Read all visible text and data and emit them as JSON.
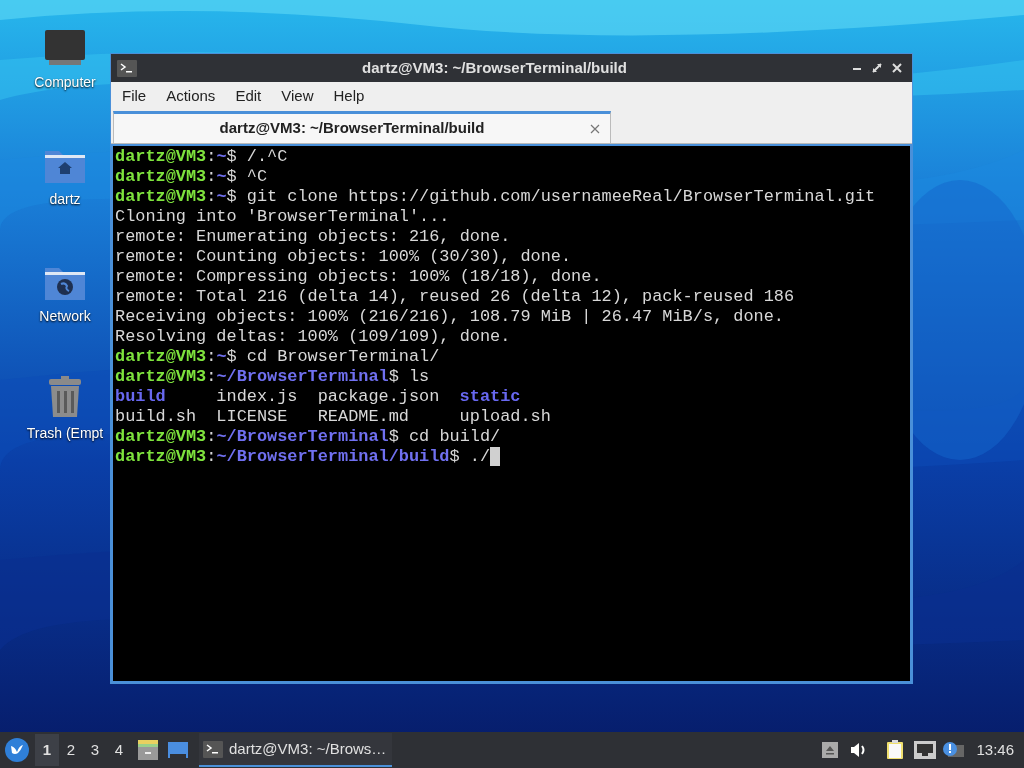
{
  "desktop_icons": [
    {
      "kind": "computer",
      "label": "Computer"
    },
    {
      "kind": "home",
      "label": "dartz"
    },
    {
      "kind": "network",
      "label": "Network"
    },
    {
      "kind": "trash",
      "label": "Trash (Empt"
    }
  ],
  "window": {
    "title": "dartz@VM3: ~/BrowserTerminal/build",
    "menu": [
      "File",
      "Actions",
      "Edit",
      "View",
      "Help"
    ],
    "tabs": [
      {
        "label": "dartz@VM3: ~/BrowserTerminal/build",
        "selected": true
      }
    ],
    "terminal": [
      {
        "kind": "prompt",
        "user": "dartz@VM3",
        "separator": ":",
        "path": "~",
        "prompt_sign": "$",
        "command": "/.^C",
        "cursor": false
      },
      {
        "kind": "prompt",
        "user": "dartz@VM3",
        "separator": ":",
        "path": "~",
        "prompt_sign": "$",
        "command": "^C",
        "cursor": false
      },
      {
        "kind": "prompt",
        "user": "dartz@VM3",
        "separator": ":",
        "path": "~",
        "prompt_sign": "$",
        "command": "git clone https://github.com/usernameeReal/BrowserTerminal.git",
        "cursor": false
      },
      {
        "kind": "output",
        "text": "Cloning into 'BrowserTerminal'..."
      },
      {
        "kind": "output",
        "text": "remote: Enumerating objects: 216, done."
      },
      {
        "kind": "output",
        "text": "remote: Counting objects: 100% (30/30), done."
      },
      {
        "kind": "output",
        "text": "remote: Compressing objects: 100% (18/18), done."
      },
      {
        "kind": "output",
        "text": "remote: Total 216 (delta 14), reused 26 (delta 12), pack-reused 186"
      },
      {
        "kind": "output",
        "text": "Receiving objects: 100% (216/216), 108.79 MiB | 26.47 MiB/s, done."
      },
      {
        "kind": "output",
        "text": "Resolving deltas: 100% (109/109), done."
      },
      {
        "kind": "prompt",
        "user": "dartz@VM3",
        "separator": ":",
        "path": "~",
        "prompt_sign": "$",
        "command": "cd BrowserTerminal/",
        "cursor": false
      },
      {
        "kind": "prompt",
        "user": "dartz@VM3",
        "separator": ":",
        "path": "~/BrowserTerminal",
        "prompt_sign": "$",
        "command": "ls",
        "cursor": false
      },
      {
        "kind": "listing",
        "items": [
          {
            "name": "build",
            "directory": true
          },
          {
            "name": "index.js",
            "directory": false
          },
          {
            "name": "package.json",
            "directory": false
          },
          {
            "name": "static",
            "directory": true
          }
        ]
      },
      {
        "kind": "listing",
        "items": [
          {
            "name": "build.sh",
            "directory": false
          },
          {
            "name": "LICENSE",
            "directory": false
          },
          {
            "name": "README.md",
            "directory": false
          },
          {
            "name": "upload.sh",
            "directory": false
          }
        ]
      },
      {
        "kind": "prompt",
        "user": "dartz@VM3",
        "separator": ":",
        "path": "~/BrowserTerminal",
        "prompt_sign": "$",
        "command": "cd build/",
        "cursor": false
      },
      {
        "kind": "prompt",
        "user": "dartz@VM3",
        "separator": ":",
        "path": "~/BrowserTerminal/build",
        "prompt_sign": "$",
        "command": "./",
        "cursor": true
      }
    ]
  },
  "taskbar": {
    "workspaces": [
      {
        "label": "1",
        "selected": true
      },
      {
        "label": "2",
        "selected": false
      },
      {
        "label": "3",
        "selected": false
      },
      {
        "label": "4",
        "selected": false
      }
    ],
    "tasks": [
      {
        "label": "dartz@VM3: ~/Brows…",
        "selected": true
      }
    ],
    "clock": "13:46"
  }
}
